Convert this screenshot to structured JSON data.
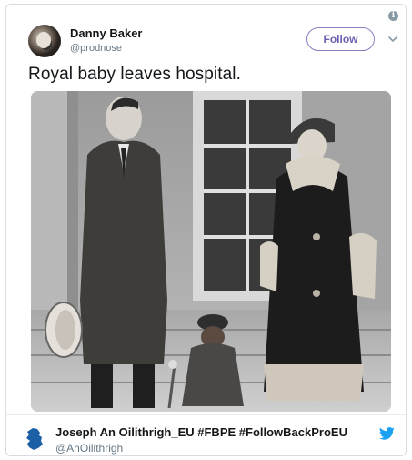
{
  "tweet": {
    "author_name": "Danny Baker",
    "author_handle": "@prodnose",
    "follow_label": "Follow",
    "text": "Royal baby leaves hospital.",
    "media": "photo"
  },
  "quoted_account": {
    "name": "Joseph An Oilithrigh_EU #FBPE #FollowBackProEU",
    "handle": "@AnOilithrigh"
  },
  "icons": {
    "info": "info-icon",
    "menu": "chevron-down-icon",
    "avatar": "avatar",
    "brand": "twitter-bird-icon",
    "flag": "ireland-map-icon"
  },
  "colors": {
    "follow_accent": "#6f5fb2",
    "handle_gray": "#657786",
    "twitter_blue": "#1da1f2",
    "ireland_blue": "#1b5fa6"
  }
}
